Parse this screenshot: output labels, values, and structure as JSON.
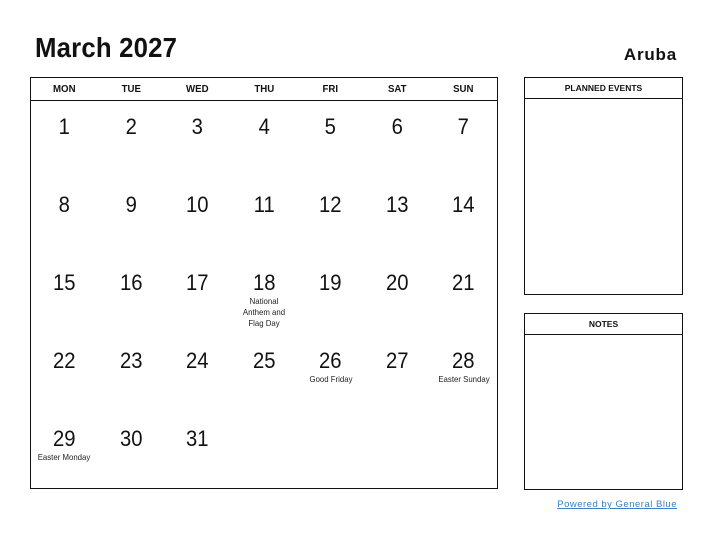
{
  "header": {
    "title": "March 2027",
    "country": "Aruba"
  },
  "calendar": {
    "weekdays": [
      "MON",
      "TUE",
      "WED",
      "THU",
      "FRI",
      "SAT",
      "SUN"
    ],
    "weeks": [
      [
        {
          "day": "1",
          "event": ""
        },
        {
          "day": "2",
          "event": ""
        },
        {
          "day": "3",
          "event": ""
        },
        {
          "day": "4",
          "event": ""
        },
        {
          "day": "5",
          "event": ""
        },
        {
          "day": "6",
          "event": ""
        },
        {
          "day": "7",
          "event": ""
        }
      ],
      [
        {
          "day": "8",
          "event": ""
        },
        {
          "day": "9",
          "event": ""
        },
        {
          "day": "10",
          "event": ""
        },
        {
          "day": "11",
          "event": ""
        },
        {
          "day": "12",
          "event": ""
        },
        {
          "day": "13",
          "event": ""
        },
        {
          "day": "14",
          "event": ""
        }
      ],
      [
        {
          "day": "15",
          "event": ""
        },
        {
          "day": "16",
          "event": ""
        },
        {
          "day": "17",
          "event": ""
        },
        {
          "day": "18",
          "event": "National Anthem and Flag Day"
        },
        {
          "day": "19",
          "event": ""
        },
        {
          "day": "20",
          "event": ""
        },
        {
          "day": "21",
          "event": ""
        }
      ],
      [
        {
          "day": "22",
          "event": ""
        },
        {
          "day": "23",
          "event": ""
        },
        {
          "day": "24",
          "event": ""
        },
        {
          "day": "25",
          "event": ""
        },
        {
          "day": "26",
          "event": "Good Friday"
        },
        {
          "day": "27",
          "event": ""
        },
        {
          "day": "28",
          "event": "Easter Sunday"
        }
      ],
      [
        {
          "day": "29",
          "event": "Easter Monday"
        },
        {
          "day": "30",
          "event": ""
        },
        {
          "day": "31",
          "event": ""
        },
        {
          "day": "",
          "event": ""
        },
        {
          "day": "",
          "event": ""
        },
        {
          "day": "",
          "event": ""
        },
        {
          "day": "",
          "event": ""
        }
      ]
    ]
  },
  "panels": {
    "planned_events": "PLANNED EVENTS",
    "notes": "NOTES"
  },
  "footer": {
    "link_text": "Powered by General Blue",
    "link_color": "#3a7fc7"
  }
}
